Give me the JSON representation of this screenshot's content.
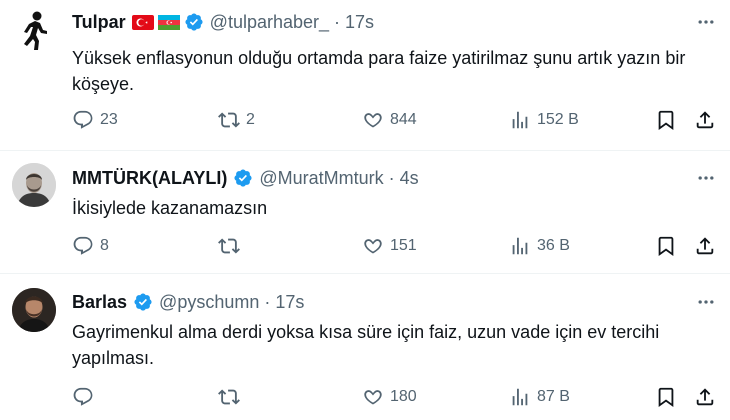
{
  "tweets": [
    {
      "name": "Tulpar",
      "handle": "@tulparhaber_",
      "separator": "·",
      "time": "17s",
      "text": "Yüksek enflasyonun olduğu ortamda para faize yatirilmaz şunu artık yazın bir köşeye.",
      "counts": {
        "reply": "23",
        "retweet": "2",
        "like": "844",
        "views": "152 B"
      },
      "flags": [
        "turkey-flag-icon",
        "azerbaijan-flag-icon"
      ]
    },
    {
      "name": "MMTÜRK(ALAYLI)",
      "handle": "@MuratMmturk",
      "separator": "·",
      "time": "4s",
      "text": "İkisiylede kazanamazsın",
      "counts": {
        "reply": "8",
        "retweet": "",
        "like": "151",
        "views": "36 B"
      }
    },
    {
      "name": "Barlas",
      "handle": "@pyschumn",
      "separator": "·",
      "time": "17s",
      "text": "Gayrimenkul alma derdi yoksa kısa süre için faiz, uzun vade için ev tercihi yapılması.",
      "counts": {
        "reply": "",
        "retweet": "",
        "like": "180",
        "views": "87 B"
      }
    }
  ],
  "colors": {
    "verified": "#1d9bf0",
    "secondary_text": "#536471",
    "primary_text": "#0f1419",
    "divider": "#eff3f4"
  },
  "icons": [
    "reply-icon",
    "retweet-icon",
    "like-icon",
    "views-icon",
    "bookmark-icon",
    "share-icon",
    "more-icon",
    "verified-icon"
  ]
}
